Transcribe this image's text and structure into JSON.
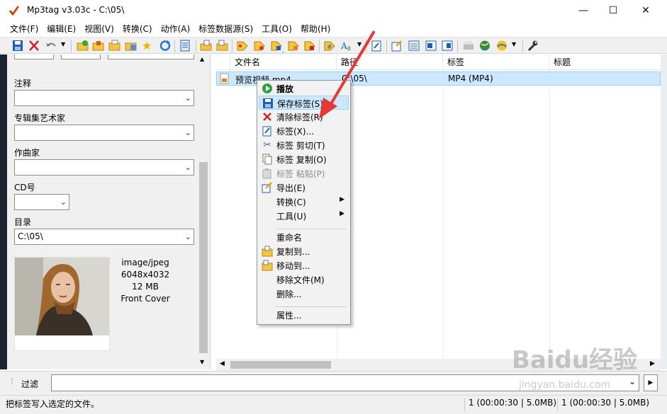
{
  "window": {
    "title": "Mp3tag v3.03c  -  C:\\05\\"
  },
  "menubar": {
    "items": [
      "文件(F)",
      "编辑(E)",
      "视图(V)",
      "转换(C)",
      "动作(A)",
      "标签数据源(S)",
      "工具(O)",
      "帮助(H)"
    ]
  },
  "left_panel": {
    "fields": [
      {
        "label": "注释",
        "value": ""
      },
      {
        "label": "专辑集艺术家",
        "value": ""
      },
      {
        "label": "作曲家",
        "value": ""
      },
      {
        "label": "CD号",
        "value": ""
      },
      {
        "label": "目录",
        "value": "C:\\05\\"
      }
    ],
    "cover": {
      "mime": "image/jpeg",
      "dimensions": "6048x4032",
      "size": "12 MB",
      "type": "Front Cover"
    }
  },
  "file_list": {
    "columns": [
      "文件名",
      "路径",
      "标签",
      "标题"
    ],
    "rows": [
      {
        "filename": "预览视频.mp4",
        "path": "C:\\05\\",
        "tag": "MP4 (MP4)",
        "title": ""
      }
    ]
  },
  "context_menu": {
    "items": [
      {
        "label": "播放",
        "icon": "play-icon"
      },
      {
        "label": "保存标签(S)",
        "icon": "save-icon"
      },
      {
        "label": "清除标签(R)",
        "icon": "delete-icon"
      },
      {
        "label": "标签(X)...",
        "icon": "tag-edit-icon"
      },
      {
        "label": "标签 剪切(T)",
        "icon": "scissors-icon"
      },
      {
        "label": "标签 复制(O)",
        "icon": "copy-icon"
      },
      {
        "label": "标签 粘贴(P)",
        "icon": "paste-icon"
      },
      {
        "label": "导出(E)",
        "icon": "export-icon"
      },
      {
        "label": "转换(C)",
        "icon": ""
      },
      {
        "label": "工具(U)",
        "icon": ""
      },
      {
        "label": "重命名",
        "icon": ""
      },
      {
        "label": "复制到...",
        "icon": "folder-copy-icon"
      },
      {
        "label": "移动到...",
        "icon": "folder-move-icon"
      },
      {
        "label": "移除文件(M)",
        "icon": ""
      },
      {
        "label": "删除...",
        "icon": ""
      },
      {
        "label": "属性...",
        "icon": ""
      }
    ]
  },
  "filter": {
    "label": "过滤",
    "value": ""
  },
  "statusbar": {
    "message": "把标签写入选定的文件。",
    "selection": "1 (00:00:30 | 5.0MB)",
    "total": "1 (00:00:30 | 5.0MB)"
  },
  "watermark": {
    "text": "Baidu经验",
    "url": "jingyan.baidu.com"
  },
  "colors": {
    "selection": "#cce8ff",
    "selection_border": "#99d1ff",
    "arrow": "#e53935"
  }
}
